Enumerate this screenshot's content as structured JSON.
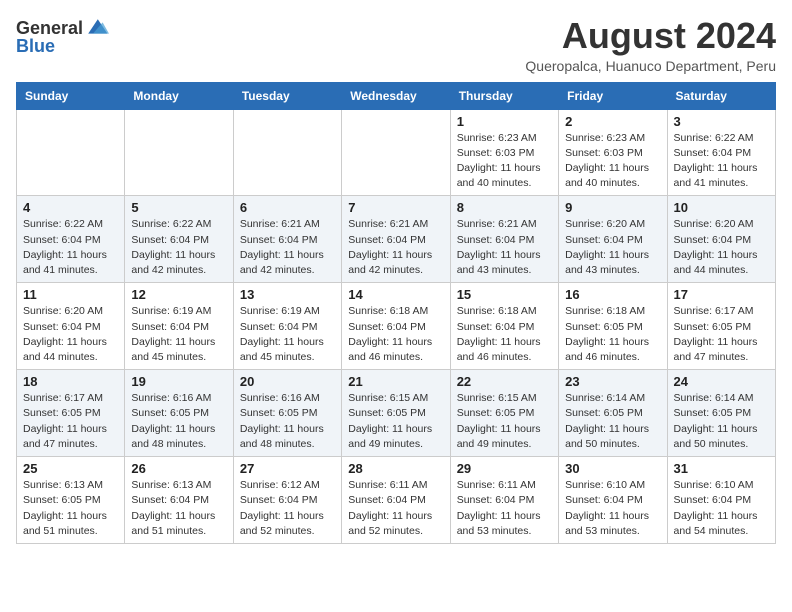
{
  "header": {
    "logo_general": "General",
    "logo_blue": "Blue",
    "month_year": "August 2024",
    "location": "Queropalca, Huanuco Department, Peru"
  },
  "weekdays": [
    "Sunday",
    "Monday",
    "Tuesday",
    "Wednesday",
    "Thursday",
    "Friday",
    "Saturday"
  ],
  "weeks": [
    [
      {
        "day": "",
        "info": ""
      },
      {
        "day": "",
        "info": ""
      },
      {
        "day": "",
        "info": ""
      },
      {
        "day": "",
        "info": ""
      },
      {
        "day": "1",
        "sunrise": "6:23 AM",
        "sunset": "6:03 PM",
        "daylight": "11 hours and 40 minutes."
      },
      {
        "day": "2",
        "sunrise": "6:23 AM",
        "sunset": "6:03 PM",
        "daylight": "11 hours and 40 minutes."
      },
      {
        "day": "3",
        "sunrise": "6:22 AM",
        "sunset": "6:04 PM",
        "daylight": "11 hours and 41 minutes."
      }
    ],
    [
      {
        "day": "4",
        "sunrise": "6:22 AM",
        "sunset": "6:04 PM",
        "daylight": "11 hours and 41 minutes."
      },
      {
        "day": "5",
        "sunrise": "6:22 AM",
        "sunset": "6:04 PM",
        "daylight": "11 hours and 42 minutes."
      },
      {
        "day": "6",
        "sunrise": "6:21 AM",
        "sunset": "6:04 PM",
        "daylight": "11 hours and 42 minutes."
      },
      {
        "day": "7",
        "sunrise": "6:21 AM",
        "sunset": "6:04 PM",
        "daylight": "11 hours and 42 minutes."
      },
      {
        "day": "8",
        "sunrise": "6:21 AM",
        "sunset": "6:04 PM",
        "daylight": "11 hours and 43 minutes."
      },
      {
        "day": "9",
        "sunrise": "6:20 AM",
        "sunset": "6:04 PM",
        "daylight": "11 hours and 43 minutes."
      },
      {
        "day": "10",
        "sunrise": "6:20 AM",
        "sunset": "6:04 PM",
        "daylight": "11 hours and 44 minutes."
      }
    ],
    [
      {
        "day": "11",
        "sunrise": "6:20 AM",
        "sunset": "6:04 PM",
        "daylight": "11 hours and 44 minutes."
      },
      {
        "day": "12",
        "sunrise": "6:19 AM",
        "sunset": "6:04 PM",
        "daylight": "11 hours and 45 minutes."
      },
      {
        "day": "13",
        "sunrise": "6:19 AM",
        "sunset": "6:04 PM",
        "daylight": "11 hours and 45 minutes."
      },
      {
        "day": "14",
        "sunrise": "6:18 AM",
        "sunset": "6:04 PM",
        "daylight": "11 hours and 46 minutes."
      },
      {
        "day": "15",
        "sunrise": "6:18 AM",
        "sunset": "6:04 PM",
        "daylight": "11 hours and 46 minutes."
      },
      {
        "day": "16",
        "sunrise": "6:18 AM",
        "sunset": "6:05 PM",
        "daylight": "11 hours and 46 minutes."
      },
      {
        "day": "17",
        "sunrise": "6:17 AM",
        "sunset": "6:05 PM",
        "daylight": "11 hours and 47 minutes."
      }
    ],
    [
      {
        "day": "18",
        "sunrise": "6:17 AM",
        "sunset": "6:05 PM",
        "daylight": "11 hours and 47 minutes."
      },
      {
        "day": "19",
        "sunrise": "6:16 AM",
        "sunset": "6:05 PM",
        "daylight": "11 hours and 48 minutes."
      },
      {
        "day": "20",
        "sunrise": "6:16 AM",
        "sunset": "6:05 PM",
        "daylight": "11 hours and 48 minutes."
      },
      {
        "day": "21",
        "sunrise": "6:15 AM",
        "sunset": "6:05 PM",
        "daylight": "11 hours and 49 minutes."
      },
      {
        "day": "22",
        "sunrise": "6:15 AM",
        "sunset": "6:05 PM",
        "daylight": "11 hours and 49 minutes."
      },
      {
        "day": "23",
        "sunrise": "6:14 AM",
        "sunset": "6:05 PM",
        "daylight": "11 hours and 50 minutes."
      },
      {
        "day": "24",
        "sunrise": "6:14 AM",
        "sunset": "6:05 PM",
        "daylight": "11 hours and 50 minutes."
      }
    ],
    [
      {
        "day": "25",
        "sunrise": "6:13 AM",
        "sunset": "6:05 PM",
        "daylight": "11 hours and 51 minutes."
      },
      {
        "day": "26",
        "sunrise": "6:13 AM",
        "sunset": "6:04 PM",
        "daylight": "11 hours and 51 minutes."
      },
      {
        "day": "27",
        "sunrise": "6:12 AM",
        "sunset": "6:04 PM",
        "daylight": "11 hours and 52 minutes."
      },
      {
        "day": "28",
        "sunrise": "6:11 AM",
        "sunset": "6:04 PM",
        "daylight": "11 hours and 52 minutes."
      },
      {
        "day": "29",
        "sunrise": "6:11 AM",
        "sunset": "6:04 PM",
        "daylight": "11 hours and 53 minutes."
      },
      {
        "day": "30",
        "sunrise": "6:10 AM",
        "sunset": "6:04 PM",
        "daylight": "11 hours and 53 minutes."
      },
      {
        "day": "31",
        "sunrise": "6:10 AM",
        "sunset": "6:04 PM",
        "daylight": "11 hours and 54 minutes."
      }
    ]
  ]
}
